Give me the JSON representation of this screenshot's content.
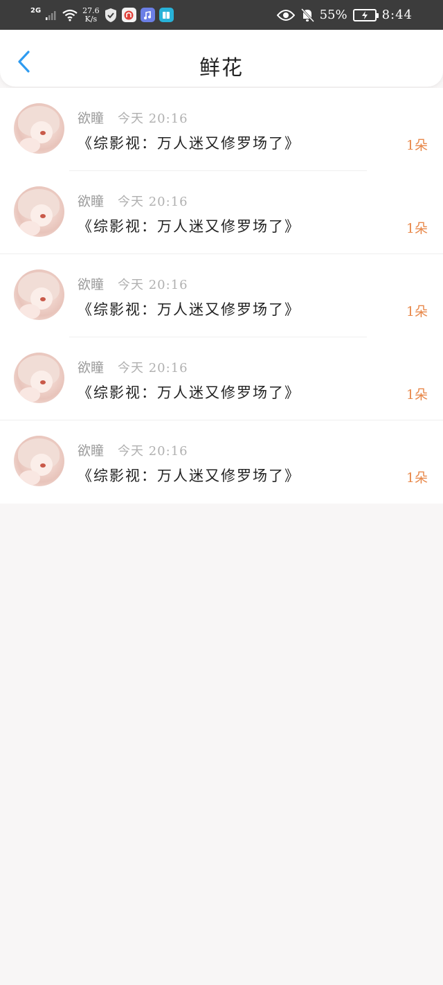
{
  "status_bar": {
    "network": "2G",
    "speed_value": "27.6",
    "speed_unit": "K/s",
    "battery_percent": "55%",
    "time": "8:44"
  },
  "header": {
    "title": "鲜花"
  },
  "items": [
    {
      "user": "欲瞳",
      "time": "今天 20:16",
      "title": "《综影视：万人迷又修罗场了》",
      "count": "1朵"
    },
    {
      "user": "欲瞳",
      "time": "今天 20:16",
      "title": "《综影视：万人迷又修罗场了》",
      "count": "1朵"
    },
    {
      "user": "欲瞳",
      "time": "今天 20:16",
      "title": "《综影视：万人迷又修罗场了》",
      "count": "1朵"
    },
    {
      "user": "欲瞳",
      "time": "今天 20:16",
      "title": "《综影视：万人迷又修罗场了》",
      "count": "1朵"
    },
    {
      "user": "欲瞳",
      "time": "今天 20:16",
      "title": "《综影视：万人迷又修罗场了》",
      "count": "1朵"
    }
  ],
  "colors": {
    "accent_count": "#e8884a",
    "back_arrow": "#2e9bf0",
    "status_bar_bg": "#3c3c3c"
  }
}
